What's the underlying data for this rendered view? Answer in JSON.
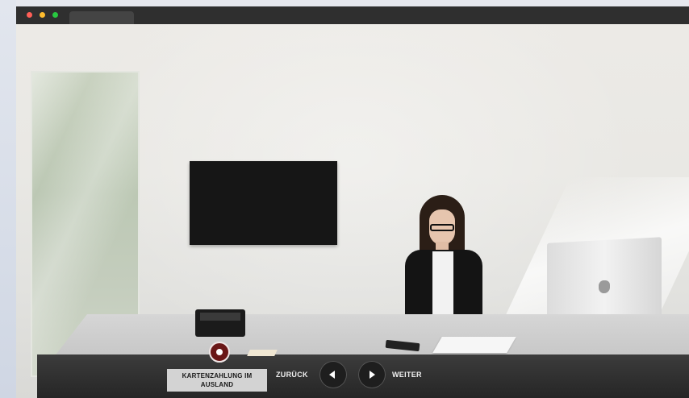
{
  "window": {
    "controls": [
      "close",
      "minimize",
      "maximize"
    ]
  },
  "player": {
    "topic_label": "KARTENZAHLUNG IM AUSLAND",
    "back_label": "ZURÜCK",
    "next_label": "WEITER",
    "record_icon": "record-icon",
    "back_icon": "arrow-left-icon",
    "next_icon": "arrow-right-icon",
    "accent_color": "#6a1717"
  }
}
